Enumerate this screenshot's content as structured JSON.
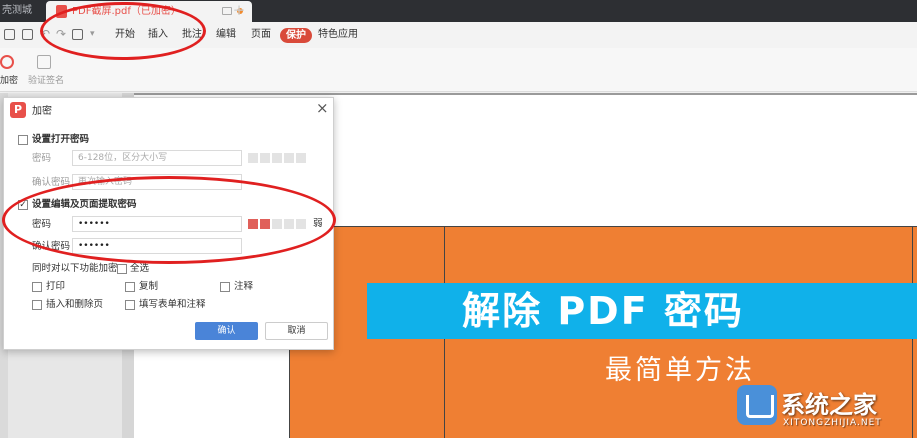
{
  "tabbar": {
    "home_tab": "壳测城",
    "active_tab_title": "PDF截屏.pdf（已加密）",
    "add_tab": "+"
  },
  "menubar": {
    "items": [
      "开始",
      "插入",
      "批注",
      "编辑",
      "页面",
      "保护",
      "特色应用"
    ],
    "active_item": "保护"
  },
  "ribbon": {
    "encrypt_label": "加密",
    "verify_signature_label": "验证签名"
  },
  "dialog": {
    "title": "加密",
    "close": "×",
    "open_password": {
      "checkbox_label": "设置打开密码",
      "checked": false,
      "password_label": "密码",
      "password_placeholder": "6-128位，区分大小写",
      "confirm_label": "确认密码",
      "confirm_placeholder": "再次输入密码"
    },
    "edit_password": {
      "checkbox_label": "设置编辑及页面提取密码",
      "checked": true,
      "check_mark": "✓",
      "password_label": "密码",
      "password_value": "••••••",
      "confirm_label": "确认密码",
      "confirm_value": "••••••",
      "strength_text": "弱",
      "strength_level": 2
    },
    "permissions": {
      "heading": "同时对以下功能加密",
      "select_all_label": "全选",
      "options": [
        "打印",
        "复制",
        "注释",
        "插入和删除页",
        "填写表单和注释"
      ]
    },
    "ok_button": "确认",
    "cancel_button": "取消"
  },
  "document": {
    "banner_title": "解除 PDF 密码",
    "subtitle": "最简单方法"
  },
  "watermark": {
    "brand_cn": "系统之家",
    "brand_en": "XITONGZHIJIA.NET"
  },
  "colors": {
    "accent_red": "#e8504a",
    "protect_tab": "#d94a3a",
    "banner_blue": "#10b1ea",
    "table_orange": "#ef7f33",
    "ok_button_blue": "#4a84d8",
    "annotation_red": "#e02020"
  }
}
